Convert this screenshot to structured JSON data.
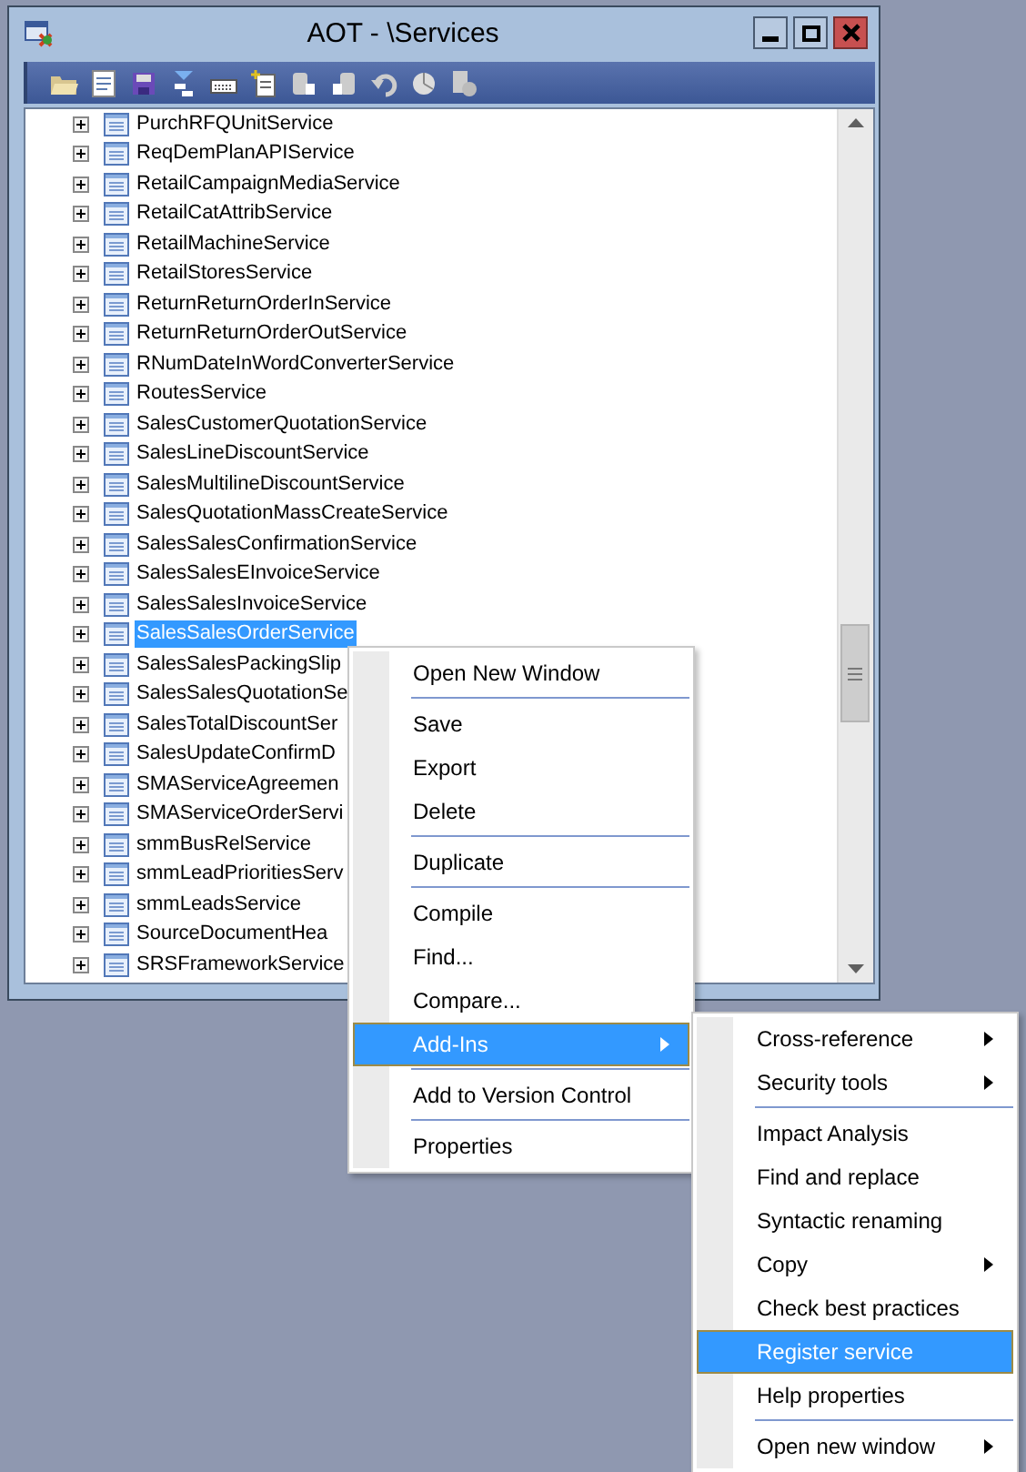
{
  "window": {
    "title": "AOT - \\Services"
  },
  "tree": {
    "items": [
      {
        "label": "PurchRFQUnitService",
        "expanded": false,
        "selected": false
      },
      {
        "label": "ReqDemPlanAPIService",
        "expanded": false,
        "selected": false
      },
      {
        "label": "RetailCampaignMediaService",
        "expanded": false,
        "selected": false
      },
      {
        "label": "RetailCatAttribService",
        "expanded": false,
        "selected": false
      },
      {
        "label": "RetailMachineService",
        "expanded": false,
        "selected": false
      },
      {
        "label": "RetailStoresService",
        "expanded": false,
        "selected": false
      },
      {
        "label": "ReturnReturnOrderInService",
        "expanded": false,
        "selected": false
      },
      {
        "label": "ReturnReturnOrderOutService",
        "expanded": false,
        "selected": false
      },
      {
        "label": "RNumDateInWordConverterService",
        "expanded": false,
        "selected": false
      },
      {
        "label": "RoutesService",
        "expanded": false,
        "selected": false
      },
      {
        "label": "SalesCustomerQuotationService",
        "expanded": false,
        "selected": false
      },
      {
        "label": "SalesLineDiscountService",
        "expanded": false,
        "selected": false
      },
      {
        "label": "SalesMultilineDiscountService",
        "expanded": false,
        "selected": false
      },
      {
        "label": "SalesQuotationMassCreateService",
        "expanded": false,
        "selected": false
      },
      {
        "label": "SalesSalesConfirmationService",
        "expanded": false,
        "selected": false
      },
      {
        "label": "SalesSalesEInvoiceService",
        "expanded": false,
        "selected": false
      },
      {
        "label": "SalesSalesInvoiceService",
        "expanded": false,
        "selected": false
      },
      {
        "label": "SalesSalesOrderService",
        "expanded": false,
        "selected": true
      },
      {
        "label": "SalesSalesPackingSlip",
        "expanded": false,
        "selected": false
      },
      {
        "label": "SalesSalesQuotationSe",
        "expanded": false,
        "selected": false
      },
      {
        "label": "SalesTotalDiscountSer",
        "expanded": false,
        "selected": false
      },
      {
        "label": "SalesUpdateConfirmD",
        "expanded": false,
        "selected": false
      },
      {
        "label": "SMAServiceAgreemen",
        "expanded": false,
        "selected": false
      },
      {
        "label": "SMAServiceOrderServi",
        "expanded": false,
        "selected": false
      },
      {
        "label": "smmBusRelService",
        "expanded": false,
        "selected": false
      },
      {
        "label": "smmLeadPrioritiesServ",
        "expanded": false,
        "selected": false
      },
      {
        "label": "smmLeadsService",
        "expanded": false,
        "selected": false
      },
      {
        "label": "SourceDocumentHea",
        "expanded": false,
        "selected": false
      },
      {
        "label": "SRSFrameworkService",
        "expanded": false,
        "selected": false
      }
    ]
  },
  "context_menu": {
    "items": [
      {
        "kind": "item",
        "label": "Open New Window",
        "submenu": false,
        "selected": false
      },
      {
        "kind": "separator"
      },
      {
        "kind": "item",
        "label": "Save",
        "submenu": false,
        "selected": false
      },
      {
        "kind": "item",
        "label": "Export",
        "submenu": false,
        "selected": false
      },
      {
        "kind": "item",
        "label": "Delete",
        "submenu": false,
        "selected": false
      },
      {
        "kind": "separator"
      },
      {
        "kind": "item",
        "label": "Duplicate",
        "submenu": false,
        "selected": false
      },
      {
        "kind": "separator"
      },
      {
        "kind": "item",
        "label": "Compile",
        "submenu": false,
        "selected": false
      },
      {
        "kind": "item",
        "label": "Find...",
        "submenu": false,
        "selected": false
      },
      {
        "kind": "item",
        "label": "Compare...",
        "submenu": false,
        "selected": false
      },
      {
        "kind": "item",
        "label": "Add-Ins",
        "submenu": true,
        "selected": true
      },
      {
        "kind": "separator"
      },
      {
        "kind": "item",
        "label": "Add to Version Control",
        "submenu": false,
        "selected": false
      },
      {
        "kind": "separator"
      },
      {
        "kind": "item",
        "label": "Properties",
        "submenu": false,
        "selected": false
      }
    ]
  },
  "submenu": {
    "items": [
      {
        "kind": "item",
        "label": "Cross-reference",
        "submenu": true,
        "selected": false
      },
      {
        "kind": "item",
        "label": "Security tools",
        "submenu": true,
        "selected": false
      },
      {
        "kind": "separator"
      },
      {
        "kind": "item",
        "label": "Impact Analysis",
        "submenu": false,
        "selected": false
      },
      {
        "kind": "item",
        "label": "Find and replace",
        "submenu": false,
        "selected": false
      },
      {
        "kind": "item",
        "label": "Syntactic renaming",
        "submenu": false,
        "selected": false
      },
      {
        "kind": "item",
        "label": "Copy",
        "submenu": true,
        "selected": false
      },
      {
        "kind": "item",
        "label": "Check best practices",
        "submenu": false,
        "selected": false
      },
      {
        "kind": "item",
        "label": "Register service",
        "submenu": false,
        "selected": true
      },
      {
        "kind": "item",
        "label": "Help properties",
        "submenu": false,
        "selected": false
      },
      {
        "kind": "separator"
      },
      {
        "kind": "item",
        "label": "Open new window",
        "submenu": true,
        "selected": false
      }
    ]
  }
}
